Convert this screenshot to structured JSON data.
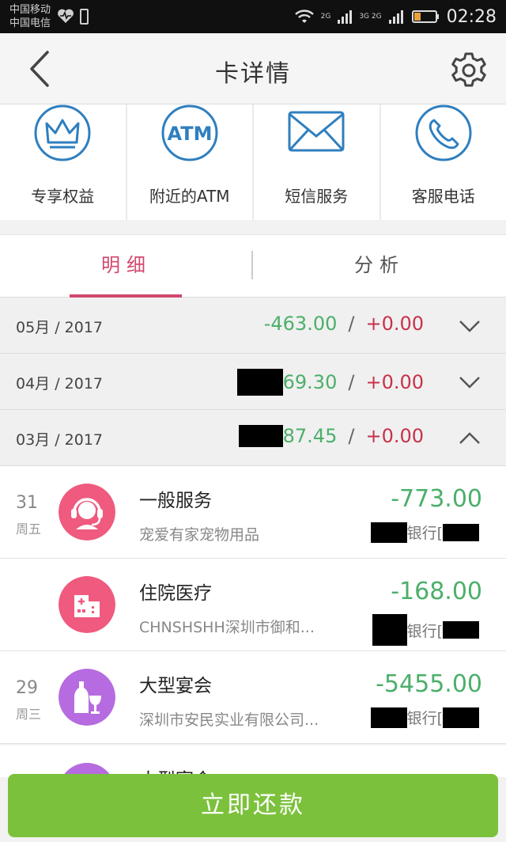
{
  "status_bar": {
    "carrier1": "中国移动",
    "carrier2": "中国电信",
    "net1": "2G",
    "net2": "3G 2G",
    "time": "02:28"
  },
  "header": {
    "title": "卡详情"
  },
  "actions": [
    {
      "label": "专享权益",
      "icon": "crown-icon",
      "icon_text": ""
    },
    {
      "label": "附近的ATM",
      "icon": "atm-icon",
      "icon_text": "ATM"
    },
    {
      "label": "短信服务",
      "icon": "envelope-icon",
      "icon_text": ""
    },
    {
      "label": "客服电话",
      "icon": "phone-icon",
      "icon_text": ""
    }
  ],
  "tabs": {
    "detail": "明细",
    "analysis": "分析",
    "active": "detail"
  },
  "months": [
    {
      "label": "05月 / 2017",
      "out": "-463.00",
      "in": "+0.00",
      "expanded": false,
      "out_redacted": false
    },
    {
      "label": "04月 / 2017",
      "out": "69.30",
      "in": "+0.00",
      "expanded": false,
      "out_redacted": true
    },
    {
      "label": "03月 / 2017",
      "out": "87.45",
      "in": "+0.00",
      "expanded": true,
      "out_redacted": true
    }
  ],
  "transactions": [
    {
      "day": "31",
      "weekday": "周五",
      "category": "一般服务",
      "merchant": "宠爱有家宠物用品",
      "amount": "-773.00",
      "bank": "银行[",
      "icon": "headset-icon",
      "color": "#ef5a7e"
    },
    {
      "day": "",
      "weekday": "",
      "category": "住院医疗",
      "merchant": "CHNSHSHH深圳市御和...",
      "amount": "-168.00",
      "bank": "银行[",
      "icon": "hospital-icon",
      "color": "#ef5a7e"
    },
    {
      "day": "29",
      "weekday": "周三",
      "category": "大型宴会",
      "merchant": "深圳市安民实业有限公司...",
      "amount": "-5455.00",
      "bank": "银行[",
      "icon": "wine-icon",
      "color": "#b66be0"
    }
  ],
  "peek": {
    "category": "大型宴会"
  },
  "repay_button": "立即还款",
  "colors": {
    "accent": "#d2486e",
    "green": "#4caf6a",
    "button": "#7cc13c",
    "icon_blue": "#2f7fbf"
  }
}
